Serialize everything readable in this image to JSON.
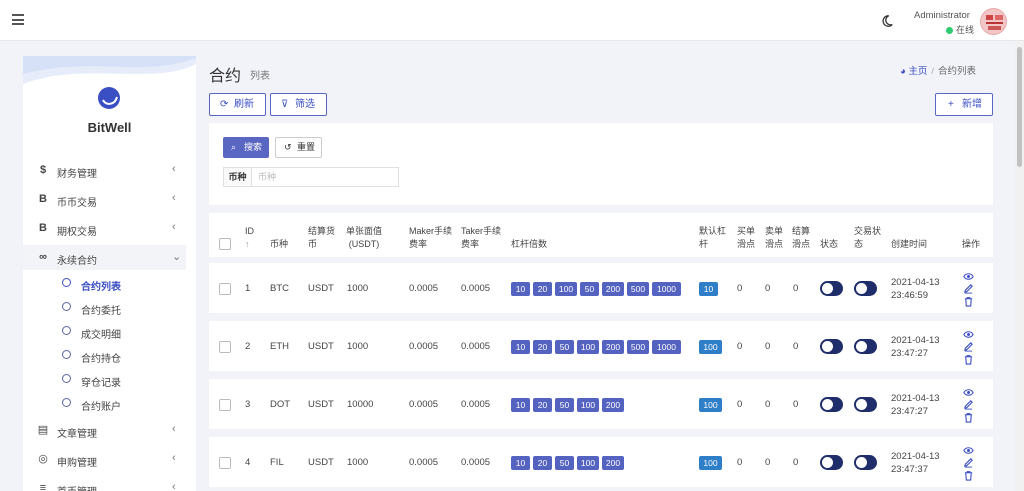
{
  "user": {
    "name": "Administrator",
    "status": "在线"
  },
  "sidebar": {
    "brand": "BitWell",
    "items": [
      {
        "icon": "$",
        "label": "财务管理"
      },
      {
        "icon": "B",
        "label": "币币交易"
      },
      {
        "icon": "B",
        "label": "期权交易"
      },
      {
        "icon": "∞",
        "label": "永续合约"
      }
    ],
    "subitems": [
      "合约列表",
      "合约委托",
      "成交明细",
      "合约持仓",
      "穿仓记录",
      "合约账户"
    ],
    "items2": [
      {
        "label": "文章管理"
      },
      {
        "label": "申购管理"
      },
      {
        "label": "首币管理"
      }
    ]
  },
  "page": {
    "title": "合约",
    "subtitle": "列表"
  },
  "breadcrumb": {
    "home": "主页",
    "sep": "/",
    "current": "合约列表"
  },
  "toolbar": {
    "refresh": "刷新",
    "filter": "筛选",
    "add": "新增"
  },
  "search": {
    "search_btn": "搜索",
    "reset_btn": "重置",
    "field_label": "币种",
    "field_placeholder": "币种"
  },
  "table": {
    "headers": {
      "id": "ID",
      "id_sort": "↑",
      "symbol": "币种",
      "settle1": "结算货",
      "settle2": "币",
      "face1": "单张面值",
      "face2": "(USDT)",
      "maker1": "Maker手续",
      "maker2": "费率",
      "taker1": "Taker手续",
      "taker2": "费率",
      "leverage": "杠杆倍数",
      "def1": "默认杠",
      "def2": "杆",
      "buy1": "买单",
      "buy2": "滑点",
      "sell1": "卖单",
      "sell2": "滑点",
      "settlep1": "结算",
      "settlep2": "滑点",
      "status": "状态",
      "trade1": "交易状",
      "trade2": "态",
      "created": "创建时间",
      "ops": "操作"
    },
    "rows": [
      {
        "id": "1",
        "symbol": "BTC",
        "settle": "USDT",
        "face": "1000",
        "maker": "0.0005",
        "taker": "0.0005",
        "lev": [
          "10",
          "20",
          "100",
          "50",
          "200",
          "500",
          "1000"
        ],
        "def": "10",
        "buy": "0",
        "sell": "0",
        "sp": "0",
        "date": "2021-04-13",
        "time": "23:46:59"
      },
      {
        "id": "2",
        "symbol": "ETH",
        "settle": "USDT",
        "face": "1000",
        "maker": "0.0005",
        "taker": "0.0005",
        "lev": [
          "10",
          "20",
          "50",
          "100",
          "200",
          "500",
          "1000"
        ],
        "def": "100",
        "buy": "0",
        "sell": "0",
        "sp": "0",
        "date": "2021-04-13",
        "time": "23:47:27"
      },
      {
        "id": "3",
        "symbol": "DOT",
        "settle": "USDT",
        "face": "10000",
        "maker": "0.0005",
        "taker": "0.0005",
        "lev": [
          "10",
          "20",
          "50",
          "100",
          "200"
        ],
        "def": "100",
        "buy": "0",
        "sell": "0",
        "sp": "0",
        "date": "2021-04-13",
        "time": "23:47:27"
      },
      {
        "id": "4",
        "symbol": "FIL",
        "settle": "USDT",
        "face": "1000",
        "maker": "0.0005",
        "taker": "0.0005",
        "lev": [
          "10",
          "20",
          "50",
          "100",
          "200"
        ],
        "def": "100",
        "buy": "0",
        "sell": "0",
        "sp": "0",
        "date": "2021-04-13",
        "time": "23:47:37"
      }
    ]
  },
  "colors": {
    "accent": "#5462c0",
    "toggle": "#1f2d6b",
    "default_badge": "#2f7fc8"
  }
}
